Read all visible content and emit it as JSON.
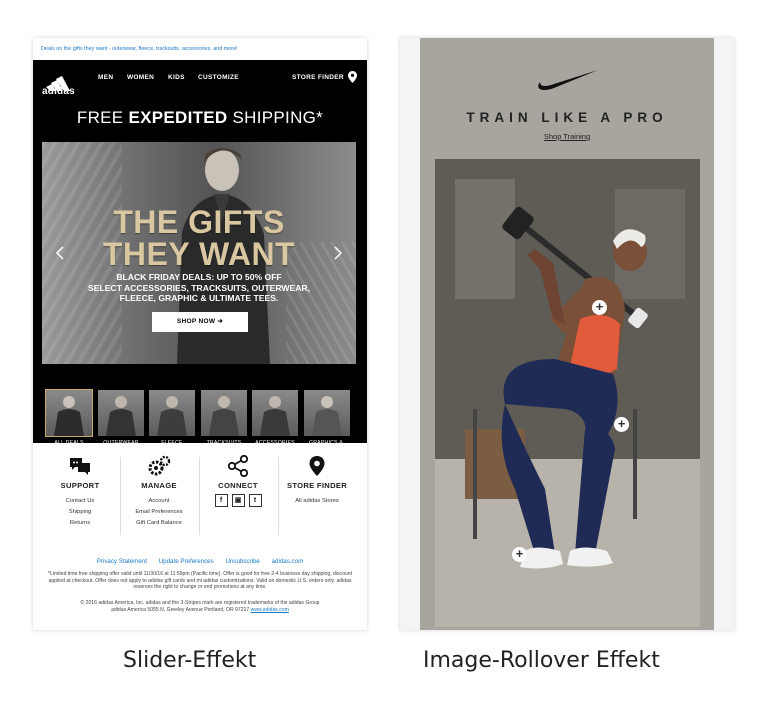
{
  "left_email": {
    "preheader": "Deals on the gifts they want - outerwear, fleece, tracksuits, accessories, and more!",
    "logo_text": "adidas",
    "nav": [
      "MEN",
      "WOMEN",
      "KIDS",
      "CUSTOMIZE"
    ],
    "store_finder_label": "STORE FINDER",
    "shipping_pre": "FREE ",
    "shipping_bold": "EXPEDITED",
    "shipping_post": " SHIPPING*",
    "hero": {
      "title_line1": "THE GIFTS",
      "title_line2": "THEY WANT",
      "sub_line1": "BLACK FRIDAY DEALS: UP TO 50% OFF",
      "sub_line2": "SELECT ACCESSORIES, TRACKSUITS, OUTERWEAR,",
      "sub_line3": "FLEECE, GRAPHIC & ULTIMATE TEES.",
      "button": "SHOP NOW ➔"
    },
    "categories": [
      {
        "label": "ALL DEALS"
      },
      {
        "label": "OUTERWEAR"
      },
      {
        "label": "FLEECE"
      },
      {
        "label": "TRACKSUITS"
      },
      {
        "label": "ACCESSORIES"
      },
      {
        "label": "GRAPHICS & ULTIMATE TEES"
      }
    ],
    "footer": {
      "support": {
        "title": "SUPPORT",
        "links": [
          "Contact Us",
          "Shipping",
          "Returns"
        ]
      },
      "manage": {
        "title": "MANAGE",
        "links": [
          "Account",
          "Email Preferences",
          "Gift Card Balance"
        ]
      },
      "connect": {
        "title": "CONNECT",
        "social": [
          "f",
          "▣",
          "t"
        ]
      },
      "store": {
        "title": "STORE FINDER",
        "links": [
          "All adidas Stores"
        ]
      }
    },
    "legal_links": [
      "Privacy Statement",
      "Update Preferences",
      "Unsubscribe",
      "adidas.com"
    ],
    "legal_text": "*Limited time free shipping offer valid until 11/30/16 at 11:59pm (Pacific time). Offer is good for free 2-4 business day shipping, discount applied at checkout. Offer does not apply to adidas gift cards and mi adidas customizations. Valid on domestic U.S. orders only. adidas reserves the right to change or end promotions at any time.",
    "copyright": "© 2016 adidas America, Inc. adidas and the 3-Stripes mark are registered trademarks of the adidas Group",
    "address": "adidas America 5055 N. Greeley Avenue Portland, OR 97217",
    "address_link": "www.adidas.com"
  },
  "right_email": {
    "headline": "TRAIN LIKE A PRO",
    "link": "Shop Training",
    "hotspot_symbol": "+"
  },
  "captions": {
    "left": "Slider-Effekt",
    "right": "Image-Rollover Effekt"
  }
}
